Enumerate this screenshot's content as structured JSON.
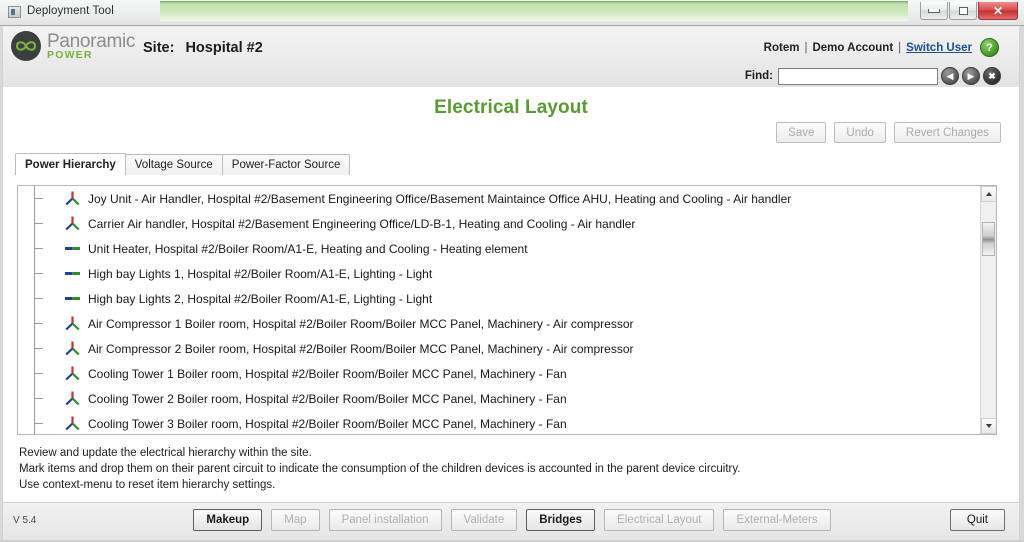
{
  "window": {
    "title": "Deployment Tool",
    "icon": "app-icon",
    "controls": {
      "minimize": "minimize",
      "maximize": "maximize",
      "close": "✕"
    }
  },
  "header": {
    "logo": {
      "brand": "Panoramic",
      "sub": "POWER",
      "tm": "™",
      "mark": "infinity-symbol"
    },
    "site_label": "Site:",
    "site_value": "Hospital #2",
    "account": {
      "user": "Rotem",
      "separator": "|",
      "account_name": "Demo Account",
      "switch_user": "Switch User",
      "help": "?"
    },
    "find": {
      "label": "Find:",
      "value": "",
      "placeholder": "",
      "prev": "◀",
      "next": "▶",
      "clear": "✖"
    }
  },
  "page": {
    "title": "Electrical Layout",
    "actions": [
      {
        "label": "Save",
        "name": "save-button",
        "enabled": false
      },
      {
        "label": "Undo",
        "name": "undo-button",
        "enabled": false
      },
      {
        "label": "Revert Changes",
        "name": "revert-changes-button",
        "enabled": false
      }
    ],
    "tabs": [
      {
        "label": "Power Hierarchy",
        "active": true
      },
      {
        "label": "Voltage Source",
        "active": false
      },
      {
        "label": "Power-Factor Source",
        "active": false
      }
    ],
    "rows": [
      {
        "icon": "three-phase-icon",
        "text": "Joy Unit - Air Handler,  Hospital #2/Basement Engineering Office/Basement Maintaince Office AHU,  Heating and Cooling -  Air handler"
      },
      {
        "icon": "three-phase-icon",
        "text": "Carrier Air handler,  Hospital #2/Basement Engineering Office/LD-B-1,  Heating and Cooling -  Air handler"
      },
      {
        "icon": "single-phase-icon",
        "text": "Unit Heater,  Hospital #2/Boiler Room/A1-E,  Heating and Cooling -  Heating element"
      },
      {
        "icon": "single-phase-icon",
        "text": "High bay Lights 1,  Hospital #2/Boiler Room/A1-E,  Lighting -  Light"
      },
      {
        "icon": "single-phase-icon",
        "text": "High bay Lights 2,  Hospital #2/Boiler Room/A1-E,  Lighting -  Light"
      },
      {
        "icon": "three-phase-icon",
        "text": "Air Compressor 1 Boiler room,  Hospital #2/Boiler Room/Boiler MCC Panel,  Machinery -  Air compressor"
      },
      {
        "icon": "three-phase-icon",
        "text": "Air Compressor 2 Boiler room,  Hospital #2/Boiler Room/Boiler MCC Panel,  Machinery -  Air compressor"
      },
      {
        "icon": "three-phase-icon",
        "text": "Cooling Tower 1 Boiler room,  Hospital #2/Boiler Room/Boiler MCC Panel,  Machinery -  Fan"
      },
      {
        "icon": "three-phase-icon",
        "text": "Cooling Tower 2 Boiler room,  Hospital #2/Boiler Room/Boiler MCC Panel,  Machinery -  Fan"
      },
      {
        "icon": "three-phase-icon",
        "text": "Cooling Tower 3 Boiler room,  Hospital #2/Boiler Room/Boiler MCC Panel,  Machinery -  Fan"
      }
    ],
    "help": {
      "line1": "Review and update the electrical hierarchy within the site.",
      "line2": "Mark items and drop them on their parent circuit to indicate the consumption of the children devices is accounted in the parent device circuitry.",
      "line3": "Use context-menu to reset item hierarchy settings."
    }
  },
  "bottom": {
    "version": "V 5.4",
    "nav": [
      {
        "label": "Makeup",
        "enabled": true
      },
      {
        "label": "Map",
        "enabled": false
      },
      {
        "label": "Panel installation",
        "enabled": false
      },
      {
        "label": "Validate",
        "enabled": false
      },
      {
        "label": "Bridges",
        "enabled": true
      },
      {
        "label": "Electrical Layout",
        "enabled": false
      },
      {
        "label": "External-Meters",
        "enabled": false
      }
    ],
    "quit": "Quit"
  },
  "colors": {
    "accent_green": "#5a9b34",
    "brand_green": "#78b23f",
    "link_blue": "#1a4f9c",
    "phase_red": "#d32f2f",
    "phase_blue": "#24409a",
    "phase_green": "#2e8b2e"
  }
}
